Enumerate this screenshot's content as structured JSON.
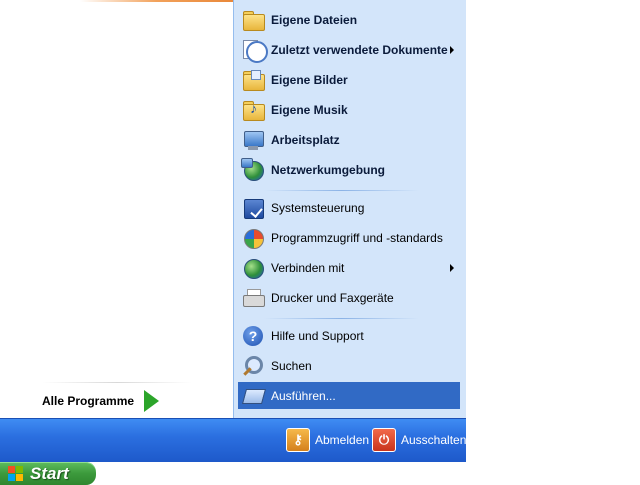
{
  "left_pane": {
    "all_programs_label": "Alle Programme"
  },
  "right_pane": {
    "group1": [
      {
        "label": "Eigene Dateien",
        "icon": "folder-icon",
        "submenu": false
      },
      {
        "label": "Zuletzt verwendete Dokumente",
        "icon": "recent-documents-icon",
        "submenu": true
      },
      {
        "label": "Eigene Bilder",
        "icon": "pictures-folder-icon",
        "submenu": false
      },
      {
        "label": "Eigene Musik",
        "icon": "music-folder-icon",
        "submenu": false
      },
      {
        "label": "Arbeitsplatz",
        "icon": "computer-icon",
        "submenu": false
      },
      {
        "label": "Netzwerkumgebung",
        "icon": "network-icon",
        "submenu": false
      }
    ],
    "group2": [
      {
        "label": "Systemsteuerung",
        "icon": "control-panel-icon",
        "submenu": false
      },
      {
        "label": "Programmzugriff und -standards",
        "icon": "program-defaults-icon",
        "submenu": false
      },
      {
        "label": "Verbinden mit",
        "icon": "connect-globe-icon",
        "submenu": true
      },
      {
        "label": "Drucker und Faxgeräte",
        "icon": "printer-icon",
        "submenu": false
      }
    ],
    "group3": [
      {
        "label": "Hilfe und Support",
        "icon": "help-icon",
        "submenu": false
      },
      {
        "label": "Suchen",
        "icon": "search-icon",
        "submenu": false
      },
      {
        "label": "Ausführen...",
        "icon": "run-icon",
        "submenu": false,
        "selected": true
      }
    ]
  },
  "bottom_bar": {
    "logoff_label": "Abmelden",
    "shutdown_label": "Ausschalten"
  },
  "taskbar": {
    "start_label": "Start"
  },
  "colors": {
    "right_pane_bg": "#d3e5fa",
    "selection": "#316ac5",
    "bottom_bar": "#2b6fe0",
    "start_button": "#3c9a3c"
  }
}
